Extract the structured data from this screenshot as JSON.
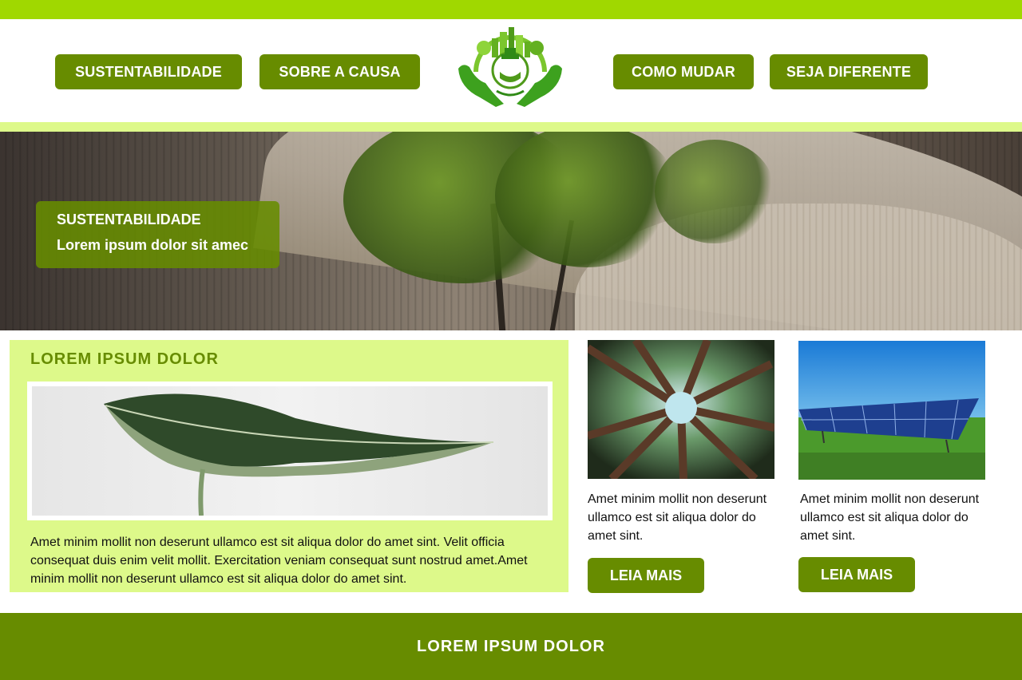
{
  "nav": {
    "left": [
      "SUSTENTABILIDADE",
      "SOBRE A CAUSA"
    ],
    "right": [
      "COMO MUDAR",
      "SEJA DIFERENTE"
    ]
  },
  "logo": {
    "icon": "eco-city-hands-logo-icon"
  },
  "hero": {
    "title": "SUSTENTABILIDADE",
    "subtitle": "Lorem ipsum dolor sit amec"
  },
  "feature": {
    "title": "LOREM IPSUM DOLOR",
    "image_icon": "leaf-image",
    "text": "Amet minim mollit non deserunt ullamco est sit aliqua dolor do amet sint. Velit officia consequat duis enim velit mollit. Exercitation veniam consequat sunt nostrud amet.Amet minim mollit non deserunt ullamco est sit aliqua dolor do amet sint."
  },
  "cards": [
    {
      "image_icon": "forest-canopy-image",
      "text": "Amet minim mollit non deserunt ullamco est sit aliqua dolor do amet sint.",
      "button": "LEIA MAIS"
    },
    {
      "image_icon": "solar-panel-image",
      "text": "Amet minim mollit non deserunt ullamco est sit aliqua dolor do amet sint.",
      "button": "LEIA MAIS"
    }
  ],
  "footer": {
    "text": "LOREM IPSUM DOLOR"
  },
  "colors": {
    "brand_green": "#678c00",
    "lime_bar": "#a0d800",
    "light_lime": "#ddf98a"
  }
}
